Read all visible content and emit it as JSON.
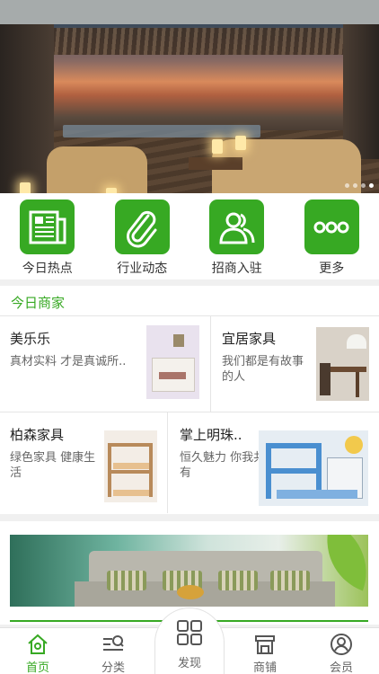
{
  "banner": {
    "slide_count": 4,
    "active_slide": 4
  },
  "quick_links": [
    {
      "label": "今日热点",
      "icon": "newspaper-icon"
    },
    {
      "label": "行业动态",
      "icon": "paperclip-icon"
    },
    {
      "label": "招商入驻",
      "icon": "people-icon"
    },
    {
      "label": "更多",
      "icon": "more-dots-icon"
    }
  ],
  "merchants": {
    "title": "今日商家",
    "items": [
      {
        "name": "美乐乐",
        "desc": "真材实料 才是真诚所.."
      },
      {
        "name": "宜居家具",
        "desc": "我们都是有故事的人"
      },
      {
        "name": "柏森家具",
        "desc": "绿色家具 健康生活"
      },
      {
        "name": "掌上明珠..",
        "desc": "恒久魅力 你我共有"
      }
    ]
  },
  "tabbar": {
    "home": "首页",
    "category": "分类",
    "discover": "发现",
    "shops": "商铺",
    "member": "会员"
  },
  "colors": {
    "accent": "#37a923",
    "divider": "#e5e5e5"
  }
}
